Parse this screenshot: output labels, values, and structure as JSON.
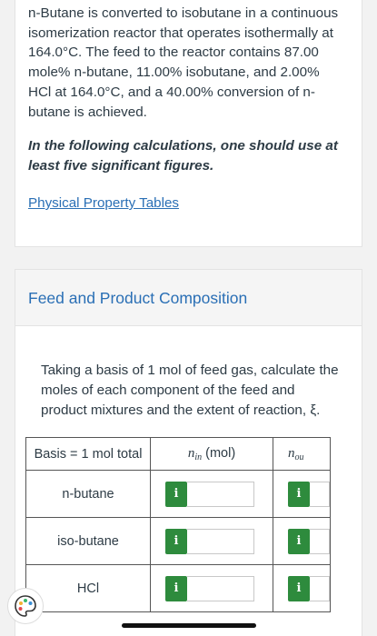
{
  "problem": {
    "text": "n-Butane is converted to isobutane in a continuous isomerization reactor that operates isothermally at 164.0°C. The feed to the reactor contains 87.00 mole% n-butane, 11.00% isobutane, and 2.00% HCl at 164.0°C, and a 40.00% conversion of n-butane is achieved.",
    "instruction": "In the following calculations, one should use at least five significant figures.",
    "link_label": "Physical Property Tables"
  },
  "section": {
    "title": "Feed and Product Composition",
    "task": "Taking a basis of 1 mol of feed gas, calculate the moles of each component of the feed and product mixtures and the extent of reaction, ξ."
  },
  "table": {
    "header_basis": "Basis = 1 mol total",
    "header_nin_symbol": "n",
    "header_nin_sub": "in",
    "header_nin_unit": " (mol)",
    "header_nout_symbol": "n",
    "header_nout_sub": "ou",
    "info_glyph": "i",
    "rows": [
      {
        "label": "n-butane"
      },
      {
        "label": "iso-butane"
      },
      {
        "label": "HCl"
      }
    ]
  },
  "colors": {
    "link": "#2a6fb5",
    "info_badge": "#2e8b3d",
    "text": "#2d3b45"
  },
  "icons": {
    "floating_button": "palette-icon"
  }
}
